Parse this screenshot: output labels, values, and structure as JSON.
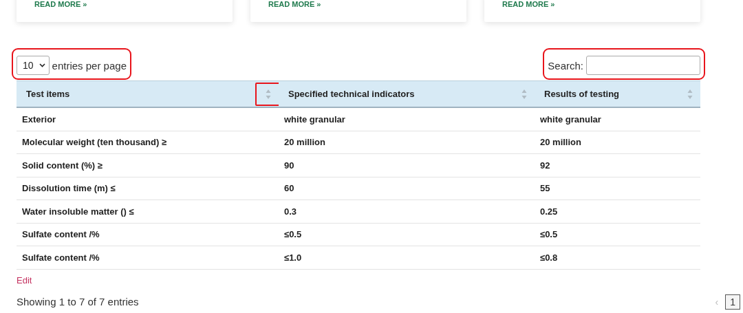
{
  "cards": [
    {
      "link": "READ MORE »"
    },
    {
      "link": "READ MORE »"
    },
    {
      "link": "READ MORE »"
    }
  ],
  "length_control": {
    "value": "10",
    "label": "entries per page",
    "highlighted": true
  },
  "search": {
    "label": "Search:",
    "highlighted": true
  },
  "table": {
    "columns": [
      {
        "label": "Test items",
        "sort_highlighted": true
      },
      {
        "label": "Specified technical indicators",
        "sort_highlighted": false
      },
      {
        "label": "Results of testing",
        "sort_highlighted": false
      }
    ],
    "rows": [
      [
        "Exterior",
        "white granular",
        "white granular"
      ],
      [
        "Molecular weight (ten thousand) ≥",
        "20 million",
        "20 million"
      ],
      [
        "Solid content (%) ≥",
        "90",
        "92"
      ],
      [
        "Dissolution time (m) ≤",
        "60",
        "55"
      ],
      [
        "Water insoluble matter () ≤",
        "0.3",
        "0.25"
      ],
      [
        "Sulfate content /%",
        "≤0.5",
        "≤0.5"
      ],
      [
        "Sulfate content /%",
        "≤1.0",
        "≤0.8"
      ]
    ]
  },
  "edit_link": "Edit",
  "info": "Showing 1 to 7 of 7 entries",
  "pagination": {
    "previous": "‹",
    "pages": [
      {
        "label": "1",
        "selected": true
      }
    ]
  }
}
